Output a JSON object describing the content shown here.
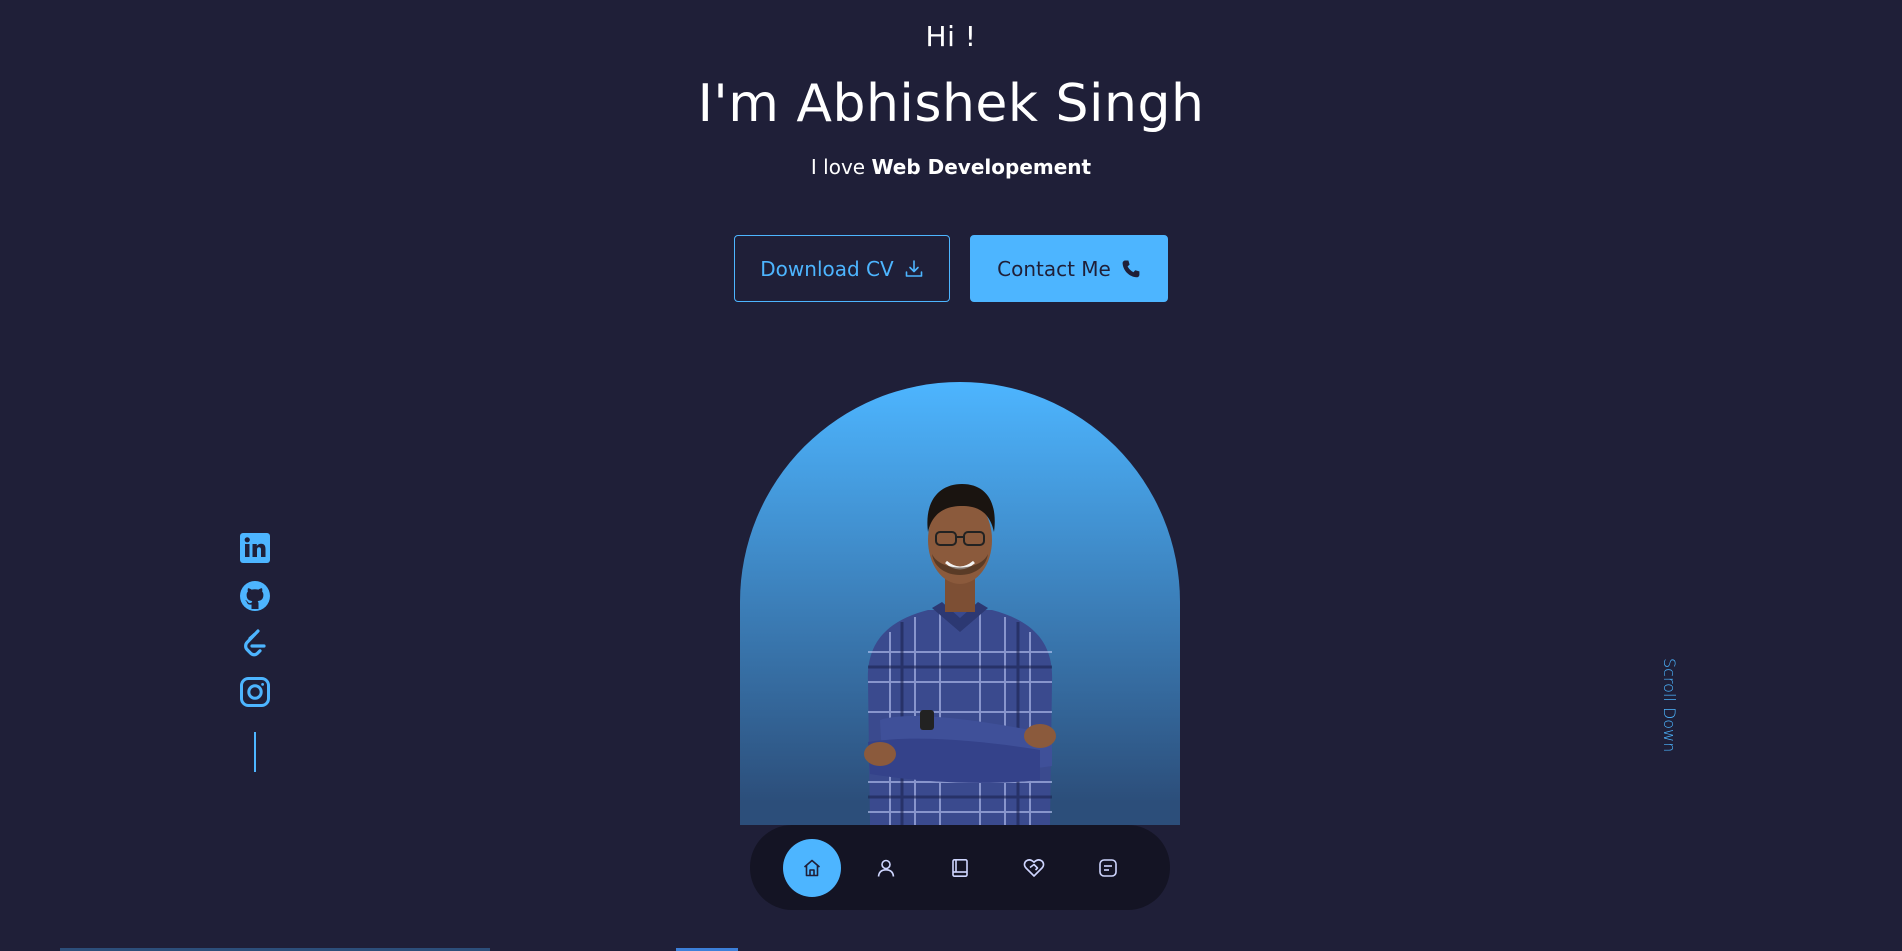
{
  "hero": {
    "greeting": "Hi !",
    "name": "I'm Abhishek Singh",
    "tagline_prefix": "I love",
    "tagline_strong": "Web Developement"
  },
  "cta": {
    "download_label": "Download CV",
    "contact_label": "Contact Me"
  },
  "socials": [
    "linkedin-icon",
    "github-icon",
    "leetcode-icon",
    "instagram-icon"
  ],
  "scroll_label": "Scroll Down",
  "nav": {
    "items": [
      "home-icon",
      "user-icon",
      "book-icon",
      "handshake-icon",
      "message-icon"
    ],
    "active": "home-icon"
  },
  "colors": {
    "background": "#1f1f38",
    "accent": "#4db5ff"
  }
}
